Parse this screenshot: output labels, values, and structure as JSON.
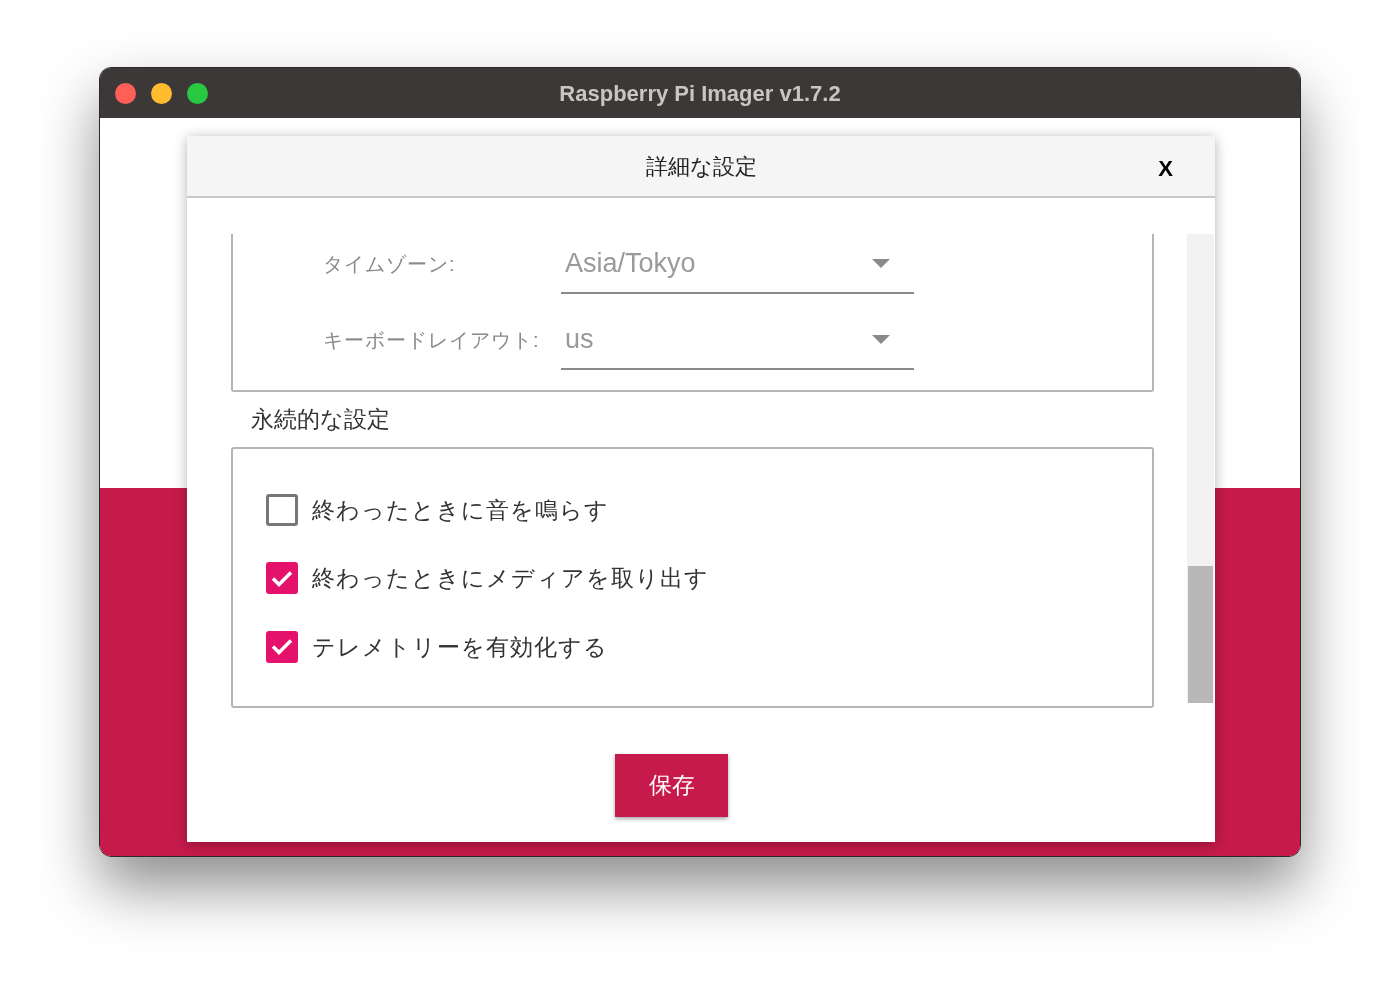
{
  "window": {
    "title": "Raspberry Pi Imager v1.7.2"
  },
  "dialog": {
    "title": "詳細な設定",
    "close": "X",
    "fields": [
      {
        "label": "タイムゾーン:",
        "value": "Asia/Tokyo"
      },
      {
        "label": "キーボードレイアウト:",
        "value": "us"
      }
    ],
    "section_title": "永続的な設定",
    "options": [
      {
        "label": "終わったときに音を鳴らす",
        "checked": false
      },
      {
        "label": "終わったときにメディアを取り出す",
        "checked": true
      },
      {
        "label": "テレメトリーを有効化する",
        "checked": true
      }
    ],
    "save_button": "保存"
  }
}
